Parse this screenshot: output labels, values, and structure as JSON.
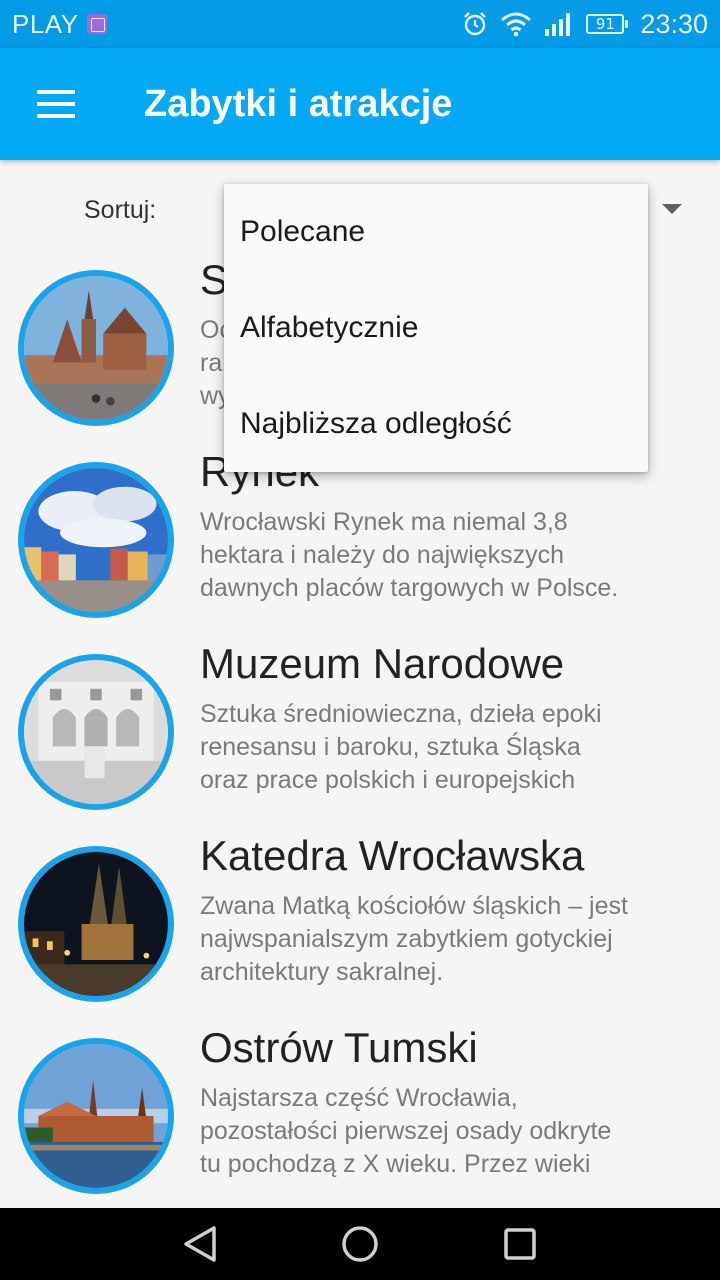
{
  "status_bar": {
    "carrier": "PLAY",
    "battery": "91",
    "time": "23:30"
  },
  "app_bar": {
    "title": "Zabytki i atrakcje",
    "menu_icon": "hamburger-menu-icon"
  },
  "sort": {
    "label": "Sortuj:",
    "options": [
      "Polecane",
      "Alfabetycznie",
      "Najbliższa odległość"
    ]
  },
  "items": [
    {
      "title": "S",
      "desc_lines": [
        "Oc",
        "ra",
        "wy"
      ]
    },
    {
      "title": "Rynek",
      "desc_lines": [
        "Wrocławski Rynek ma niemal 3,8",
        "hektara i należy do największych",
        "dawnych placów targowych w Polsce."
      ]
    },
    {
      "title": "Muzeum Narodowe",
      "desc_lines": [
        "Sztuka średniowieczna, dzieła epoki",
        "renesansu i baroku, sztuka Śląska",
        "oraz prace polskich i europejskich"
      ]
    },
    {
      "title": "Katedra Wrocławska",
      "desc_lines": [
        "Zwana Matką kościołów śląskich – jest",
        "najwspanialszym zabytkiem gotyckiej",
        "architektury sakralnej."
      ]
    },
    {
      "title": "Ostrów Tumski",
      "desc_lines": [
        "Najstarsza część Wrocławia,",
        "pozostałości pierwszej osady odkryte",
        "tu pochodzą z X wieku. Przez wieki"
      ]
    }
  ],
  "colors": {
    "primary": "#03a9f4",
    "primary_dark": "#039be5",
    "thumb_border": "#1aa3ea"
  },
  "nav": {
    "back_icon": "back-triangle-icon",
    "home_icon": "home-circle-icon",
    "recents_icon": "recents-square-icon"
  }
}
